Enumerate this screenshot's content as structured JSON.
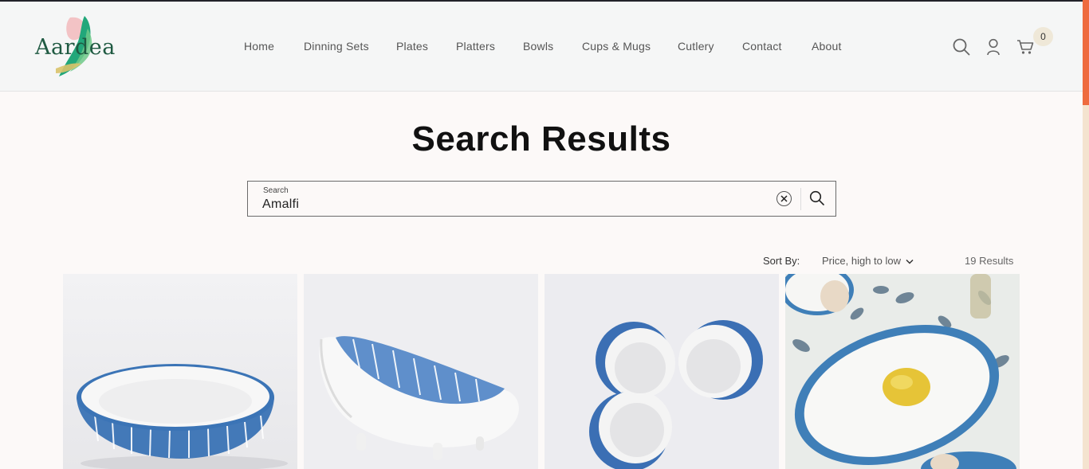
{
  "brand": {
    "logo_text": "Aardea"
  },
  "nav": {
    "items": [
      "Home",
      "Dinning Sets",
      "Plates",
      "Platters",
      "Bowls",
      "Cups & Mugs",
      "Cutlery",
      "Contact",
      "About"
    ]
  },
  "header_icons": {
    "search": "search-icon",
    "account": "user-icon",
    "cart": "cart-icon",
    "cart_count": "0"
  },
  "page": {
    "title": "Search Results"
  },
  "search": {
    "label": "Search",
    "value": "Amalfi",
    "clear_icon": "close-icon",
    "submit_icon": "search-icon"
  },
  "sort": {
    "label": "Sort By:",
    "selected": "Price, high to low",
    "results": "19 Results"
  },
  "products": [
    {
      "image": "blue striped round serving bowl"
    },
    {
      "image": "blue striped footed oval bowl"
    },
    {
      "image": "blue three-section condiment dish"
    },
    {
      "image": "blue bordered oval platter with lemon"
    }
  ],
  "colors": {
    "accent": "#ee6b3f",
    "brand_green": "#1f5a42",
    "product_blue": "#3f7fb8"
  }
}
